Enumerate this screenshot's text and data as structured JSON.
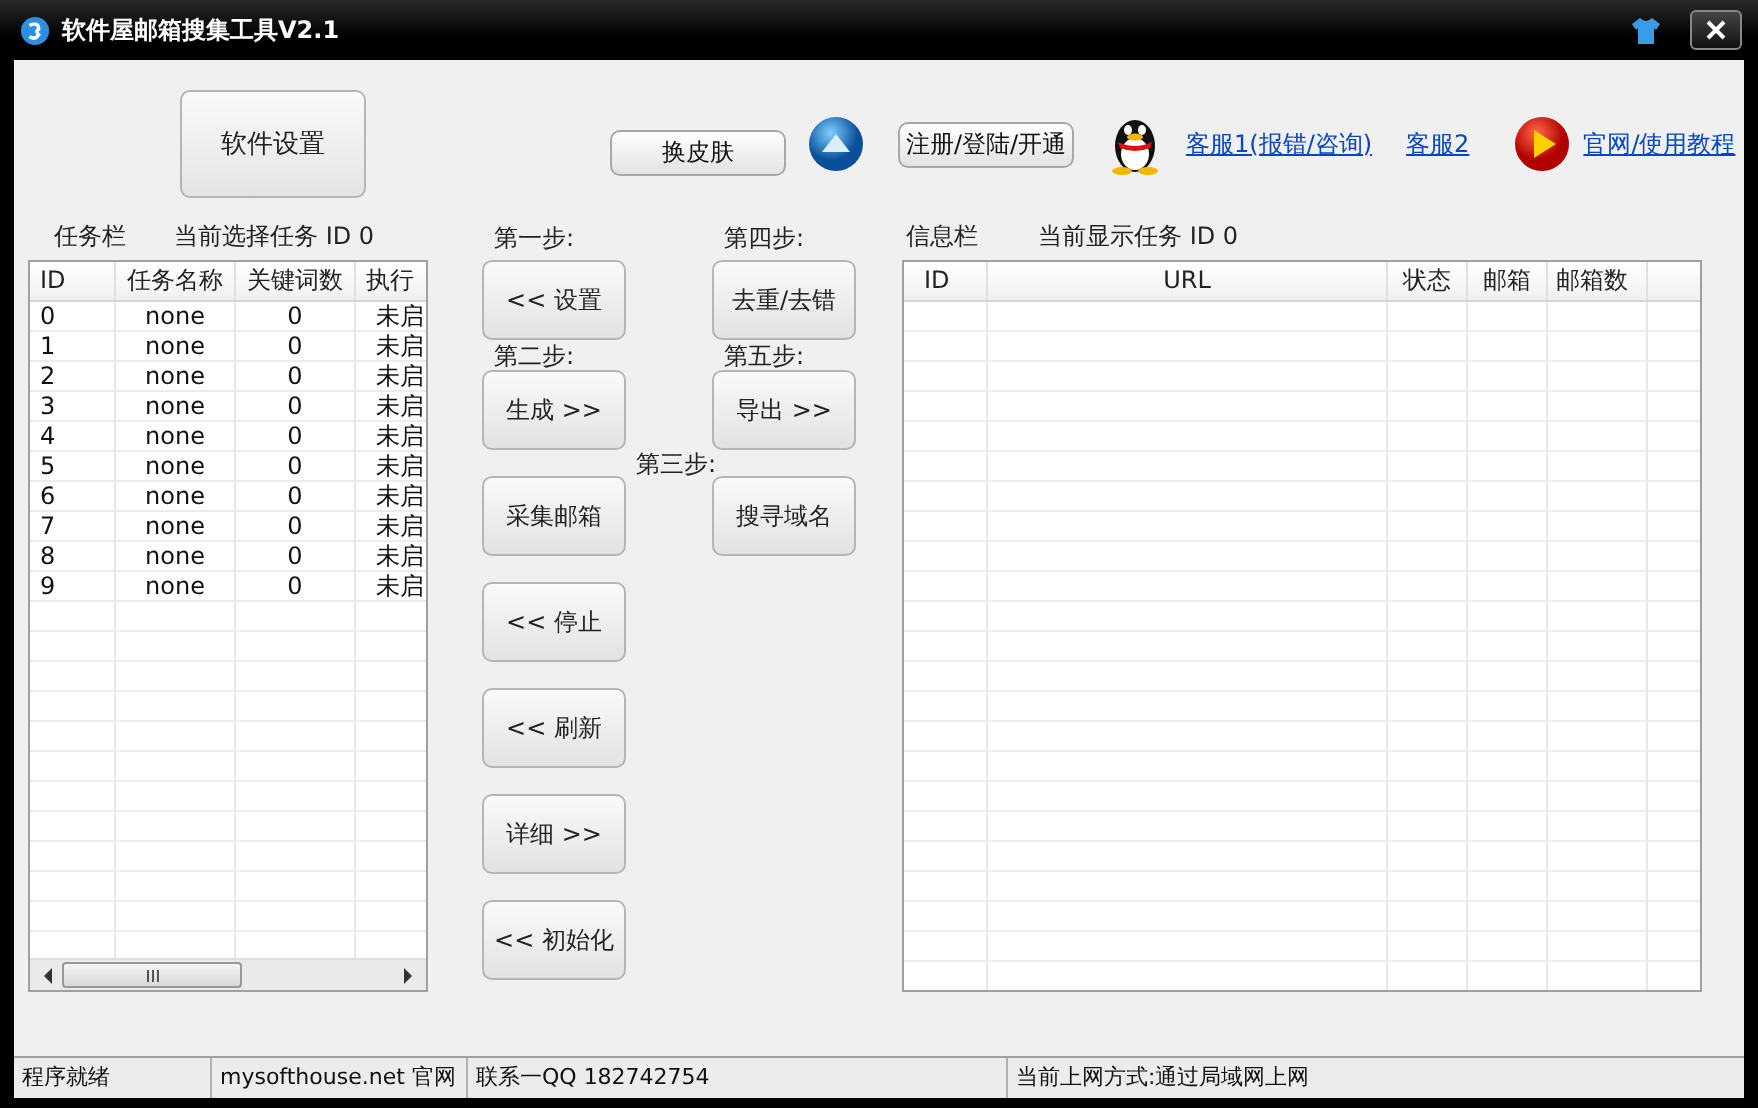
{
  "window": {
    "title": "软件屋邮箱搜集工具V2.1"
  },
  "toolbar": {
    "settings_button": "软件设置",
    "skin_button": "换皮肤",
    "register_button": "注册/登陆/开通",
    "links": [
      {
        "label": "客服1(报错/咨询)"
      },
      {
        "label": "客服2"
      },
      {
        "label": "官网/使用教程"
      }
    ]
  },
  "tasks": {
    "title": "任务栏",
    "current": "当前选择任务 ID 0",
    "columns": [
      "ID",
      "任务名称",
      "关键词数",
      "执行"
    ],
    "rows": [
      [
        "0",
        "none",
        "0",
        "未启"
      ],
      [
        "1",
        "none",
        "0",
        "未启"
      ],
      [
        "2",
        "none",
        "0",
        "未启"
      ],
      [
        "3",
        "none",
        "0",
        "未启"
      ],
      [
        "4",
        "none",
        "0",
        "未启"
      ],
      [
        "5",
        "none",
        "0",
        "未启"
      ],
      [
        "6",
        "none",
        "0",
        "未启"
      ],
      [
        "7",
        "none",
        "0",
        "未启"
      ],
      [
        "8",
        "none",
        "0",
        "未启"
      ],
      [
        "9",
        "none",
        "0",
        "未启"
      ]
    ]
  },
  "steps": {
    "column_a": [
      {
        "caption": "第一步:",
        "button": "<< 设置"
      },
      {
        "caption": "第二步:",
        "button": "生成 >>"
      },
      {
        "button": "采集邮箱"
      },
      {
        "button": "<< 停止"
      },
      {
        "button": "<< 刷新"
      },
      {
        "button": "详细 >>"
      },
      {
        "button": "<< 初始化"
      }
    ],
    "middle_caption": "第三步:",
    "column_b": [
      {
        "caption": "第四步:",
        "button": "去重/去错"
      },
      {
        "caption": "第五步:",
        "button": "导出 >>"
      },
      {
        "button": "搜寻域名"
      }
    ]
  },
  "info": {
    "title": "信息栏",
    "current": "当前显示任务 ID 0",
    "columns": [
      "ID",
      "URL",
      "状态",
      "邮箱",
      "邮箱数"
    ]
  },
  "status_bar": [
    "程序就绪",
    "mysofthouse.net 官网",
    "联系一QQ 182742754",
    "当前上网方式:通过局域网上网"
  ]
}
